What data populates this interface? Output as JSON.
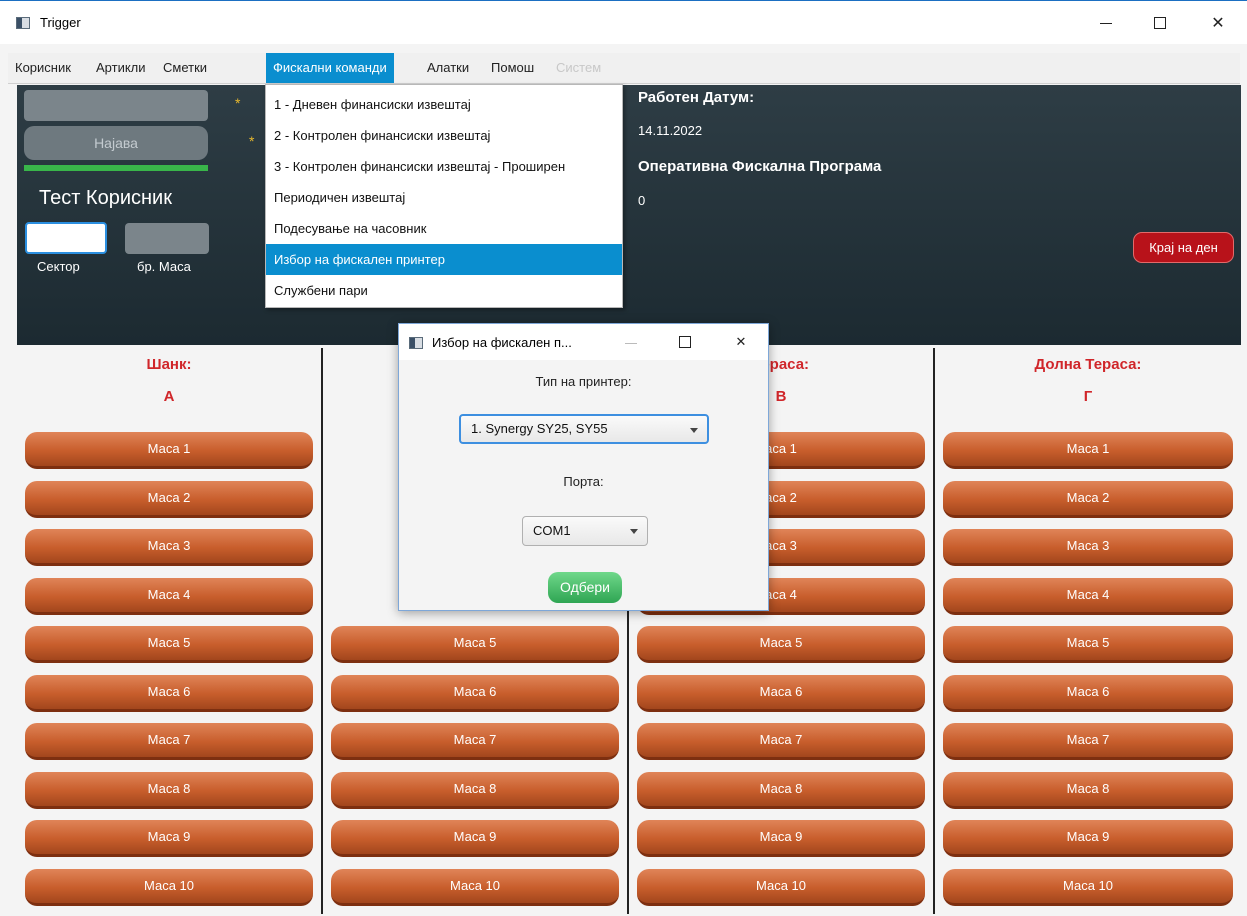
{
  "window": {
    "title": "Trigger"
  },
  "menubar": {
    "items": [
      {
        "label": "Корисник"
      },
      {
        "label": "Артикли"
      },
      {
        "label": "Сметки"
      },
      {
        "label": "Фискални команди"
      },
      {
        "label": "Алатки"
      },
      {
        "label": "Помош"
      },
      {
        "label": "Систем"
      }
    ]
  },
  "fiscal_menu": {
    "items": [
      {
        "label": "1 - Дневен финансиски извештај"
      },
      {
        "label": "2 - Контролен финансиски извештај"
      },
      {
        "label": "3 - Контролен финансиски извештај - Проширен"
      },
      {
        "label": "Периодичен извештај"
      },
      {
        "label": "Подесување на часовник"
      },
      {
        "label": "Избор на фискален принтер"
      },
      {
        "label": "Службени пари"
      }
    ]
  },
  "login": {
    "button_label": "Најава",
    "user_name": "Тест Корисник",
    "sector_label": "Сектор",
    "table_no_label": "бр. Маса"
  },
  "info": {
    "work_date_label": "Работен Датум:",
    "work_date": "14.11.2022",
    "program_label": "Оперативна Фискална Програма",
    "program_value": "0",
    "end_day_label": "Крај на ден"
  },
  "sections": [
    {
      "title": "Шанк:",
      "letter": "А"
    },
    {
      "title": "",
      "letter": ""
    },
    {
      "title": "Тераса:",
      "letter": "В"
    },
    {
      "title": "Долна Тераса:",
      "letter": "Г"
    }
  ],
  "tables": {
    "col1": [
      "Маса 1",
      "Маса 2",
      "Маса 3",
      "Маса 4",
      "Маса 5",
      "Маса 6",
      "Маса 7",
      "Маса 8",
      "Маса 9",
      "Маса 10"
    ],
    "col2": [
      "Маса 5",
      "Маса 6",
      "Маса 7",
      "Маса 8",
      "Маса 9",
      "Маса 10"
    ],
    "col3": [
      "аса 1",
      "аса 2",
      "аса 3",
      "аса 4",
      "Маса 5",
      "Маса 6",
      "Маса 7",
      "Маса 8",
      "Маса 9",
      "Маса 10"
    ],
    "col4": [
      "Маса 1",
      "Маса 2",
      "Маса 3",
      "Маса 4",
      "Маса 5",
      "Маса 6",
      "Маса 7",
      "Маса 8",
      "Маса 9",
      "Маса 10"
    ]
  },
  "dialog": {
    "title": "Избор на фискален п...",
    "printer_type_label": "Тип на принтер:",
    "printer_type_value": "1. Synergy SY25, SY55",
    "port_label": "Порта:",
    "port_value": "COM1",
    "confirm_label": "Одбери"
  }
}
